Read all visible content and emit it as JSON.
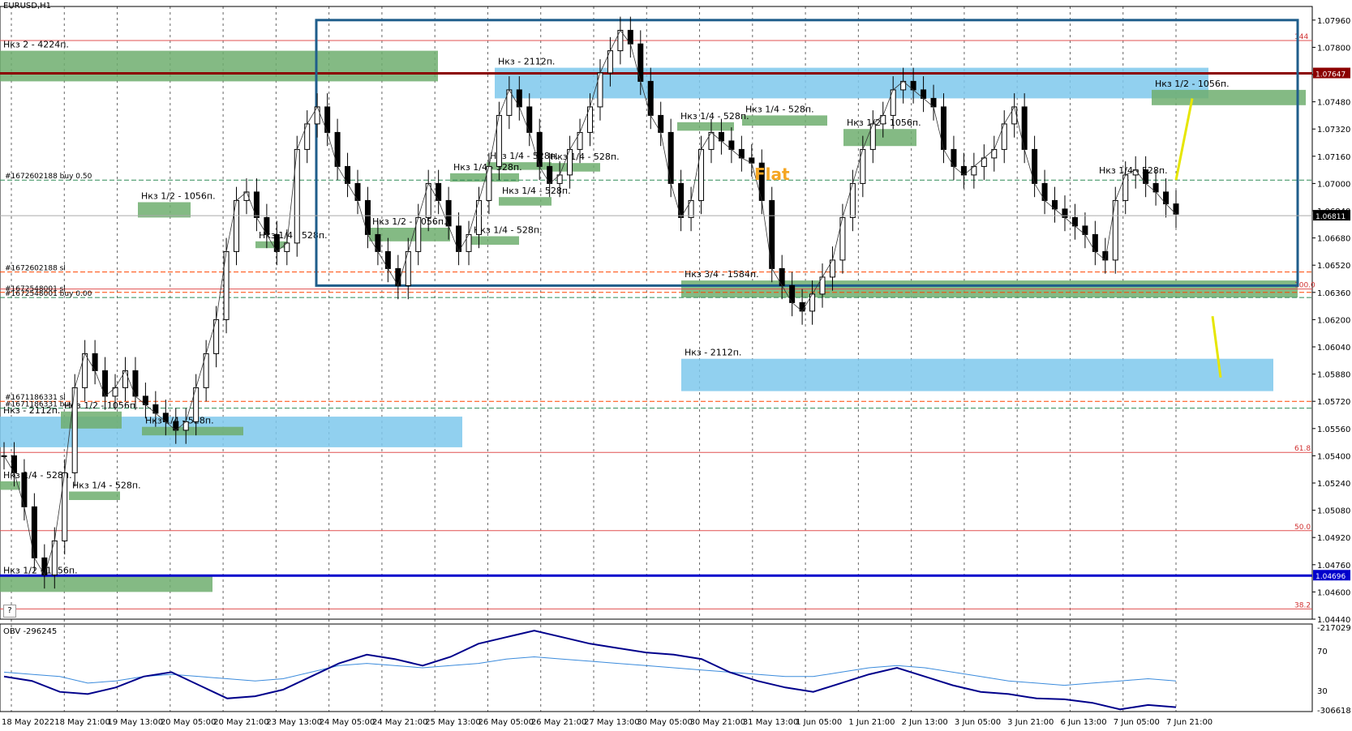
{
  "window": {
    "symbol_label": "EURUSD,H1",
    "help_label": "?"
  },
  "indicator": {
    "label": "OBV -296245"
  },
  "chart_data": {
    "type": "candlestick",
    "symbol": "EURUSD",
    "timeframe": "H1",
    "price_ticks": [
      "1.07960",
      "1.07800",
      "1.07640",
      "1.07480",
      "1.07320",
      "1.07160",
      "1.07000",
      "1.06840",
      "1.06680",
      "1.06520",
      "1.06360",
      "1.06200",
      "1.06040",
      "1.05880",
      "1.05720",
      "1.05560",
      "1.05400",
      "1.05240",
      "1.05080",
      "1.04920",
      "1.04760",
      "1.04600",
      "1.04440"
    ],
    "price_range": [
      1.0444,
      1.0804
    ],
    "time_labels": [
      "18 May 2022",
      "18 May 21:00",
      "19 May 13:00",
      "20 May 05:00",
      "20 May 21:00",
      "23 May 13:00",
      "24 May 05:00",
      "24 May 21:00",
      "25 May 13:00",
      "26 May 05:00",
      "26 May 21:00",
      "27 May 13:00",
      "30 May 05:00",
      "30 May 21:00",
      "31 May 13:00",
      "1 Jun 05:00",
      "1 Jun 21:00",
      "2 Jun 13:00",
      "3 Jun 05:00",
      "3 Jun 21:00",
      "6 Jun 13:00",
      "7 Jun 05:00",
      "7 Jun 21:00"
    ],
    "price_path": [
      1.054,
      1.053,
      1.051,
      1.048,
      1.047,
      1.049,
      1.053,
      1.058,
      1.06,
      1.059,
      1.0575,
      1.058,
      1.059,
      1.0575,
      1.057,
      1.0565,
      1.056,
      1.0555,
      1.056,
      1.058,
      1.06,
      1.062,
      1.066,
      1.069,
      1.0695,
      1.068,
      1.067,
      1.066,
      1.0665,
      1.072,
      1.0735,
      1.0745,
      1.073,
      1.071,
      1.07,
      1.069,
      1.067,
      1.066,
      1.065,
      1.064,
      1.066,
      1.068,
      1.07,
      1.069,
      1.0675,
      1.066,
      1.067,
      1.069,
      1.071,
      1.074,
      1.0755,
      1.0745,
      1.073,
      1.071,
      1.07,
      1.0705,
      1.072,
      1.073,
      1.0745,
      1.0765,
      1.0778,
      1.079,
      1.0782,
      1.076,
      1.074,
      1.073,
      1.07,
      1.068,
      1.069,
      1.072,
      1.073,
      1.0725,
      1.072,
      1.0715,
      1.0712,
      1.069,
      1.065,
      1.064,
      1.063,
      1.0625,
      1.0635,
      1.0645,
      1.0655,
      1.068,
      1.07,
      1.072,
      1.0735,
      1.074,
      1.0755,
      1.076,
      1.0755,
      1.075,
      1.0745,
      1.072,
      1.071,
      1.0705,
      1.071,
      1.0715,
      1.072,
      1.0735,
      1.0745,
      1.072,
      1.07,
      1.069,
      1.0685,
      1.068,
      1.0675,
      1.067,
      1.066,
      1.0655,
      1.069,
      1.0705,
      1.0708,
      1.07,
      1.0695,
      1.0688,
      1.0682
    ],
    "current_price_label": "1.06811",
    "horizontal_lines": [
      {
        "price": 1.07647,
        "label": "1.07647",
        "color": "#8b0000"
      },
      {
        "price": 1.04696,
        "label": "1.04696",
        "color": "#0000cc"
      }
    ],
    "fib_levels": [
      {
        "price": 1.0784,
        "label": "144"
      },
      {
        "price": 1.0638,
        "label": "100.0"
      },
      {
        "price": 1.0542,
        "label": "61.8"
      },
      {
        "price": 1.0496,
        "label": "50.0"
      },
      {
        "price": 1.045,
        "label": "38.2"
      }
    ],
    "order_lines": [
      {
        "price": 1.0702,
        "label": "#1672602188 buy 0.50",
        "color": "#2e8b57"
      },
      {
        "price": 1.0648,
        "label": "#1672602188 sl",
        "color": "#ff4500"
      },
      {
        "price": 1.0636,
        "label": "#1672548001 sl",
        "color": "#ff4500"
      },
      {
        "price": 1.0633,
        "label": "#1672548001 buy 0.00",
        "color": "#2e8b57"
      },
      {
        "price": 1.0572,
        "label": "#1671186331 sl",
        "color": "#ff4500"
      },
      {
        "price": 1.0568,
        "label": "#1671186331 buy",
        "color": "#2e8b57"
      }
    ],
    "zones": [
      {
        "label": "Нкз 2 - 4224п.",
        "color": "#6fae6f",
        "p1": 1.0778,
        "p2": 1.076
      },
      {
        "label": "Нкз - 2112п.",
        "color": "#7ec8ec",
        "p1": 1.0768,
        "p2": 1.075
      },
      {
        "label": "Нкз 1/2 - 1056п.",
        "color": "#6fae6f",
        "p1": 1.0755,
        "p2": 1.0746
      },
      {
        "label": "Нкз 1/4 - 528п.",
        "color": "#6fae6f",
        "p1": 1.074,
        "p2": 1.0734
      },
      {
        "label": "Нкз 1/2 - 1056п.",
        "color": "#6fae6f",
        "p1": 1.0732,
        "p2": 1.0722
      },
      {
        "label": "Нкз 1/4 - 528п.",
        "color": "#6fae6f",
        "p1": 1.0736,
        "p2": 1.0731
      },
      {
        "label": "Нкз 1/4 - 528п.",
        "color": "#6fae6f",
        "p1": 1.07125,
        "p2": 1.0708
      },
      {
        "label": "Нкз 1/4 - 528п.",
        "color": "#6fae6f",
        "p1": 1.0712,
        "p2": 1.0707
      },
      {
        "label": "Нкз 1/4 - 528п.",
        "color": "#6fae6f",
        "p1": 1.0706,
        "p2": 1.0701
      },
      {
        "label": "Нкз 1/4 - 528п.",
        "color": "#6fae6f",
        "p1": 1.0692,
        "p2": 1.0687
      },
      {
        "label": "Нкз 1/2 - 1056п.",
        "color": "#6fae6f",
        "p1": 1.0689,
        "p2": 1.068
      },
      {
        "label": "Нкз 1/2 - 1056п.",
        "color": "#6fae6f",
        "p1": 1.0674,
        "p2": 1.0666
      },
      {
        "label": "Нкз 1/4 - 528п.",
        "color": "#6fae6f",
        "p1": 1.0669,
        "p2": 1.0664
      },
      {
        "label": "Нкз 1/4 - 528п.",
        "color": "#6fae6f",
        "p1": 1.0666,
        "p2": 1.0662
      },
      {
        "label": "Нкз 3/4 - 1584п.",
        "color": "#6fae6f",
        "p1": 1.0643,
        "p2": 1.0633
      },
      {
        "label": "Нкз - 2112п.",
        "color": "#7ec8ec",
        "p1": 1.0597,
        "p2": 1.0578
      },
      {
        "label": "Нкз - 2112п.",
        "color": "#7ec8ec",
        "p1": 1.0563,
        "p2": 1.0545
      },
      {
        "label": "Нкз 1/2 - 1056п.",
        "color": "#6fae6f",
        "p1": 1.0566,
        "p2": 1.0556
      },
      {
        "label": "Нкз 1/4 - 528п.",
        "color": "#6fae6f",
        "p1": 1.0557,
        "p2": 1.0552
      },
      {
        "label": "Нкз 1/4 - 528п.",
        "color": "#6fae6f",
        "p1": 1.0525,
        "p2": 1.052
      },
      {
        "label": "Нкз 1/4 - 528п.",
        "color": "#6fae6f",
        "p1": 1.0519,
        "p2": 1.0514
      },
      {
        "label": "Нкз 1/2 - 1056п.",
        "color": "#6fae6f",
        "p1": 1.0469,
        "p2": 1.046
      }
    ],
    "annotations": [
      {
        "text": "Flat",
        "color": "#f5a623"
      },
      {
        "text": "Нкз 1/4 - 528п.",
        "color": "#000000"
      }
    ],
    "obv": {
      "label": "OBV -296245",
      "ticks": [
        "-217029",
        "70",
        "30",
        "-306618"
      ],
      "series_main": [
        -0.2,
        -0.3,
        -0.55,
        -0.6,
        -0.45,
        -0.2,
        -0.1,
        -0.4,
        -0.7,
        -0.65,
        -0.5,
        -0.2,
        0.1,
        0.3,
        0.2,
        0.05,
        0.25,
        0.55,
        0.7,
        0.85,
        0.7,
        0.55,
        0.45,
        0.35,
        0.3,
        0.2,
        -0.1,
        -0.3,
        -0.45,
        -0.55,
        -0.35,
        -0.15,
        0.0,
        -0.2,
        -0.4,
        -0.55,
        -0.6,
        -0.7,
        -0.72,
        -0.8,
        -0.95,
        -0.85,
        -0.9
      ],
      "series_signal": [
        -0.1,
        -0.15,
        -0.2,
        -0.35,
        -0.3,
        -0.2,
        -0.15,
        -0.2,
        -0.25,
        -0.3,
        -0.25,
        -0.1,
        0.05,
        0.1,
        0.05,
        0.0,
        0.05,
        0.1,
        0.2,
        0.25,
        0.2,
        0.15,
        0.1,
        0.05,
        0.0,
        -0.05,
        -0.1,
        -0.15,
        -0.2,
        -0.2,
        -0.1,
        0.0,
        0.05,
        0.0,
        -0.1,
        -0.2,
        -0.3,
        -0.35,
        -0.4,
        -0.35,
        -0.3,
        -0.25,
        -0.3
      ]
    }
  }
}
